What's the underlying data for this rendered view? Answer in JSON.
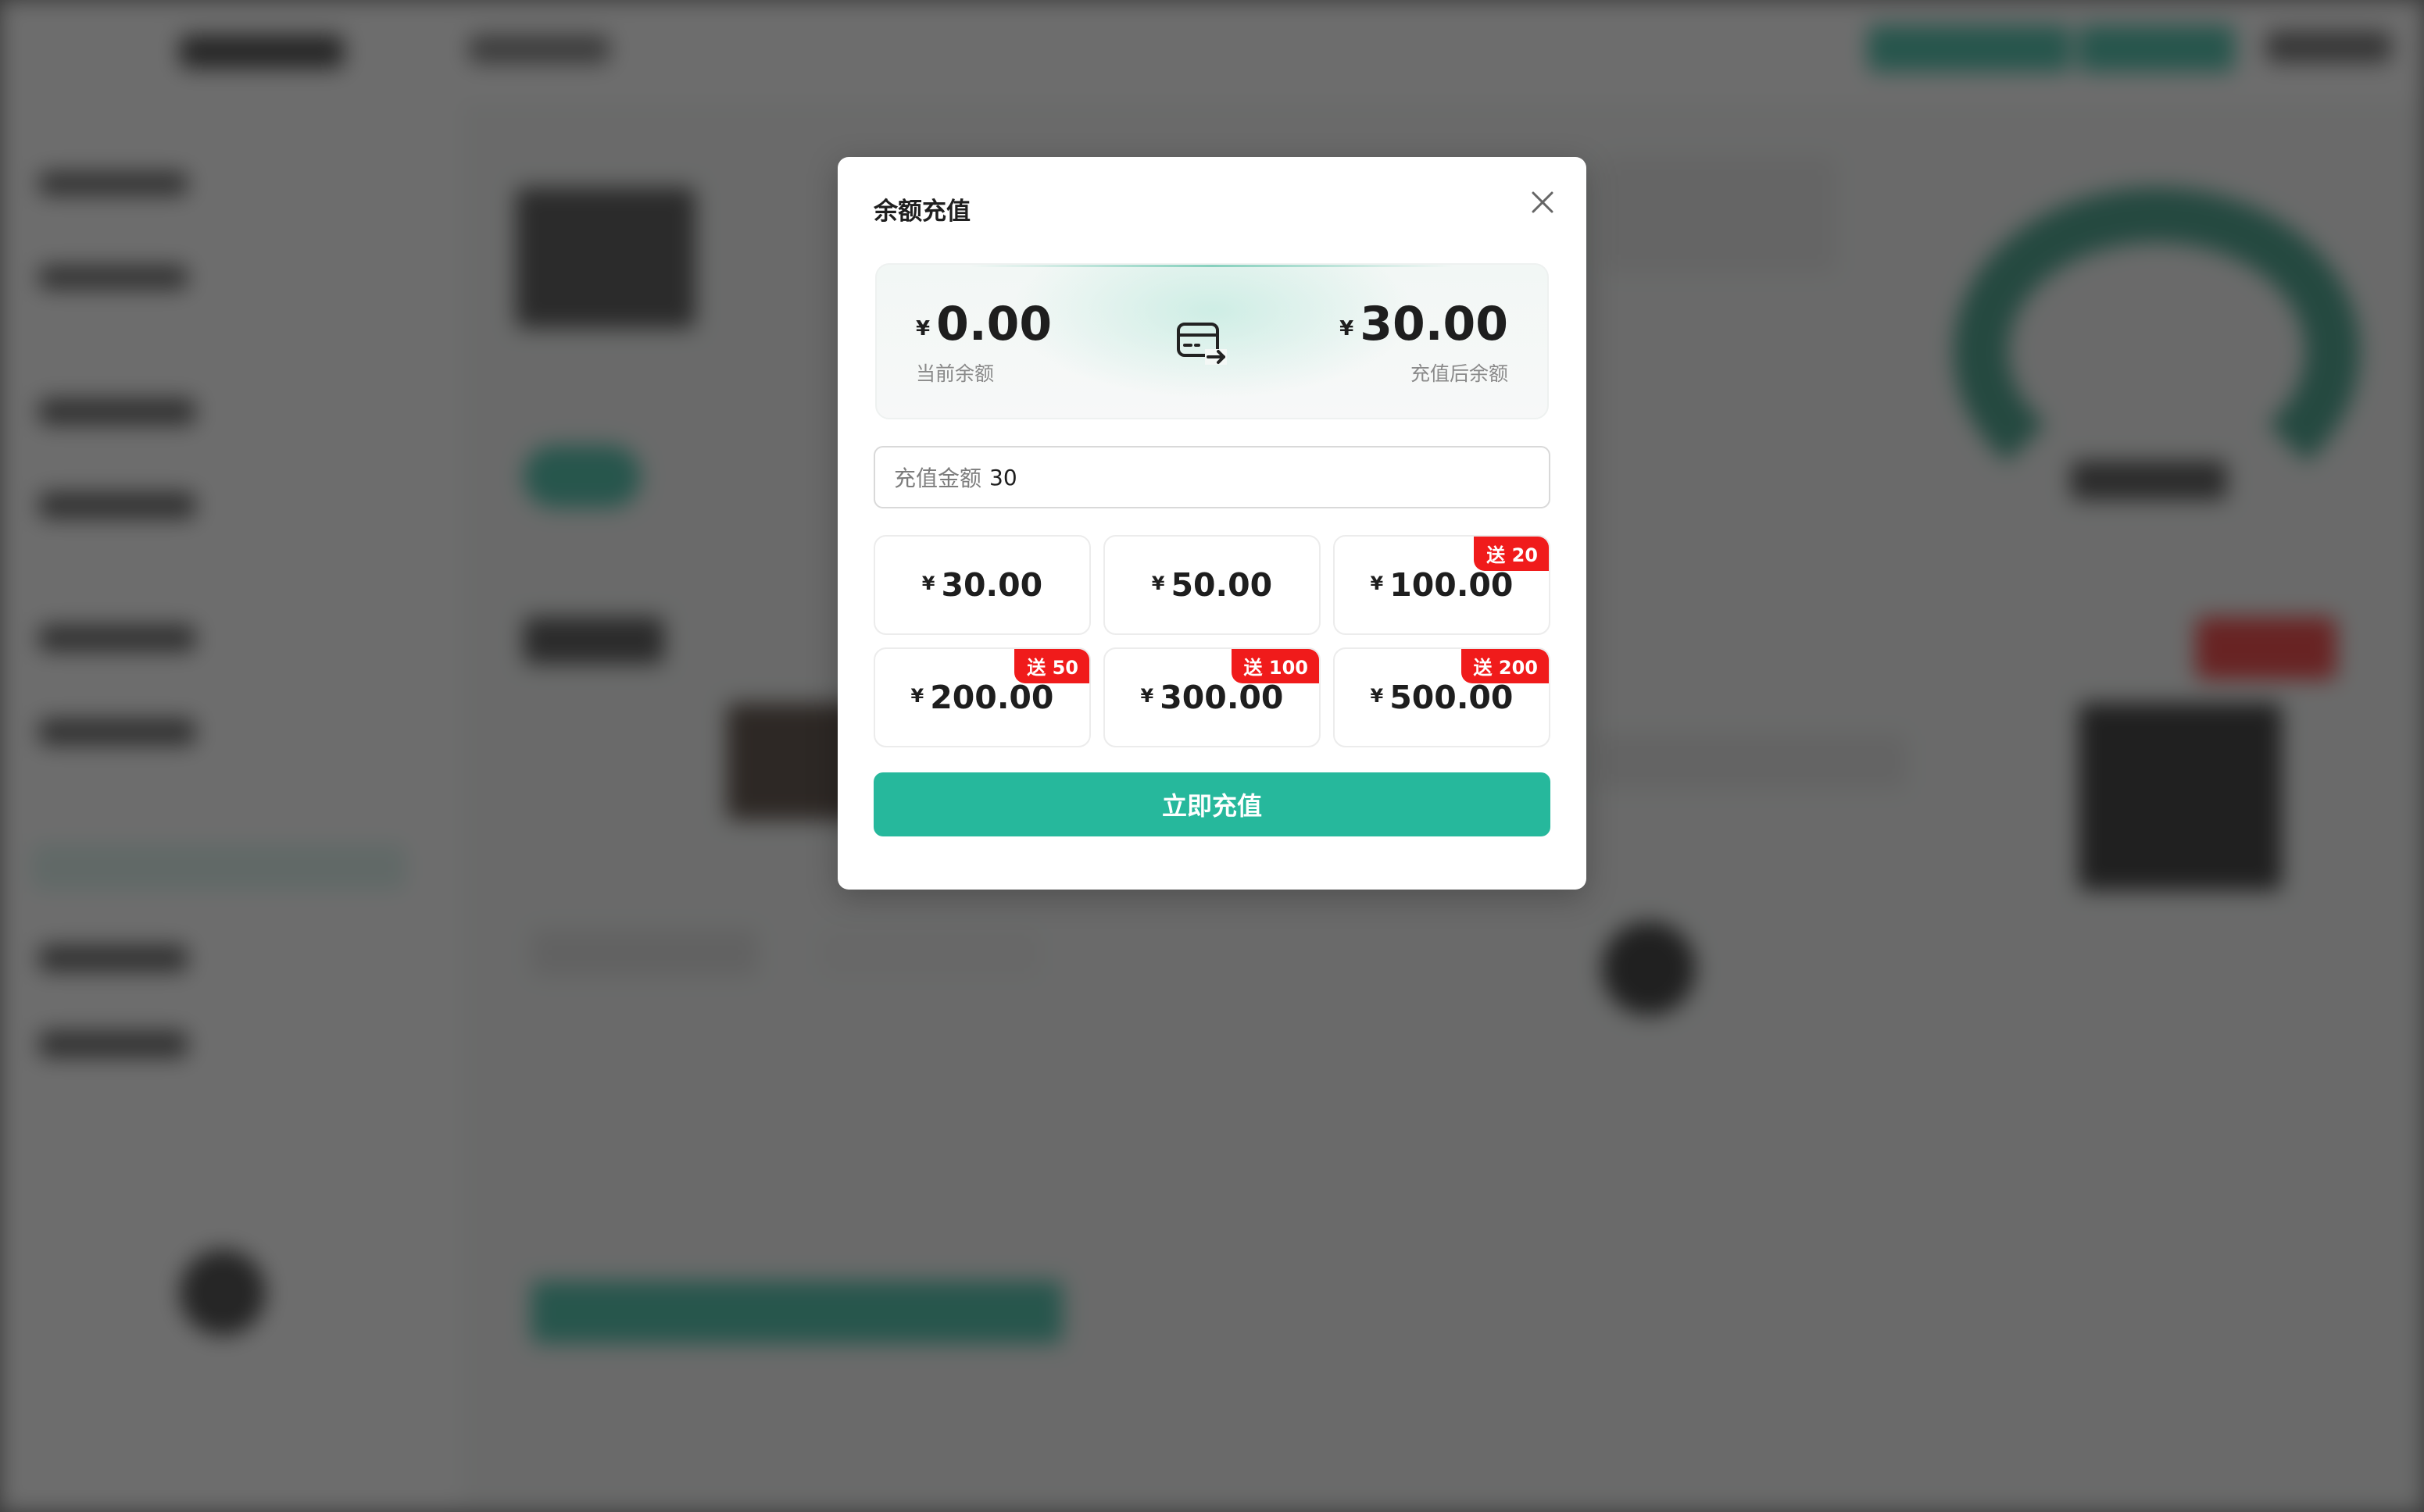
{
  "dialog": {
    "title": "余额充值",
    "close_icon": "close-icon"
  },
  "balance": {
    "currency_symbol": "¥",
    "current_amount": "0.00",
    "current_label": "当前余额",
    "after_amount": "30.00",
    "after_label": "充值后余额",
    "transfer_icon": "card-transfer-icon"
  },
  "amount_input": {
    "label": "充值金额",
    "value": "30"
  },
  "options": [
    {
      "currency": "¥",
      "amount": "30.00",
      "bonus": ""
    },
    {
      "currency": "¥",
      "amount": "50.00",
      "bonus": ""
    },
    {
      "currency": "¥",
      "amount": "100.00",
      "bonus": "送 20"
    },
    {
      "currency": "¥",
      "amount": "200.00",
      "bonus": "送 50"
    },
    {
      "currency": "¥",
      "amount": "300.00",
      "bonus": "送 100"
    },
    {
      "currency": "¥",
      "amount": "500.00",
      "bonus": "送 200"
    }
  ],
  "submit_label": "立即充值",
  "colors": {
    "accent": "#26b89c",
    "bonus_badge": "#f01b1b",
    "overlay": "#5a5a5a"
  }
}
